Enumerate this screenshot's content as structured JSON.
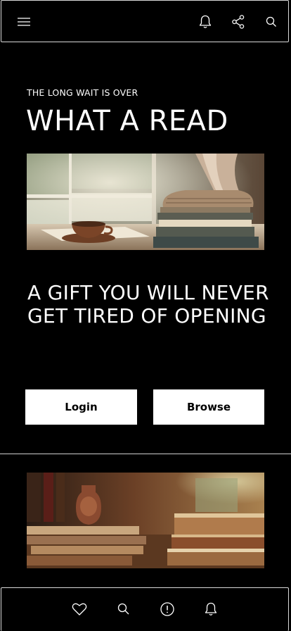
{
  "header": {
    "menu_icon": "hamburger-menu-icon",
    "notifications_icon": "bell-icon",
    "share_icon": "share-icon",
    "search_icon": "search-icon"
  },
  "hero": {
    "eyebrow": "THE LONG WAIT IS OVER",
    "headline": "WHAT A READ",
    "tagline": "A GIFT YOU WILL NEVER GET TIRED OF OPENING"
  },
  "actions": {
    "login_label": "Login",
    "browse_label": "Browse"
  },
  "bottom_nav": {
    "items": [
      {
        "icon": "heart-icon"
      },
      {
        "icon": "search-icon"
      },
      {
        "icon": "alert-icon"
      },
      {
        "icon": "bell-icon"
      }
    ]
  },
  "colors": {
    "background": "#000000",
    "text": "#ffffff",
    "button_bg": "#ffffff",
    "button_text": "#000000",
    "border": "#d9d9d9"
  }
}
